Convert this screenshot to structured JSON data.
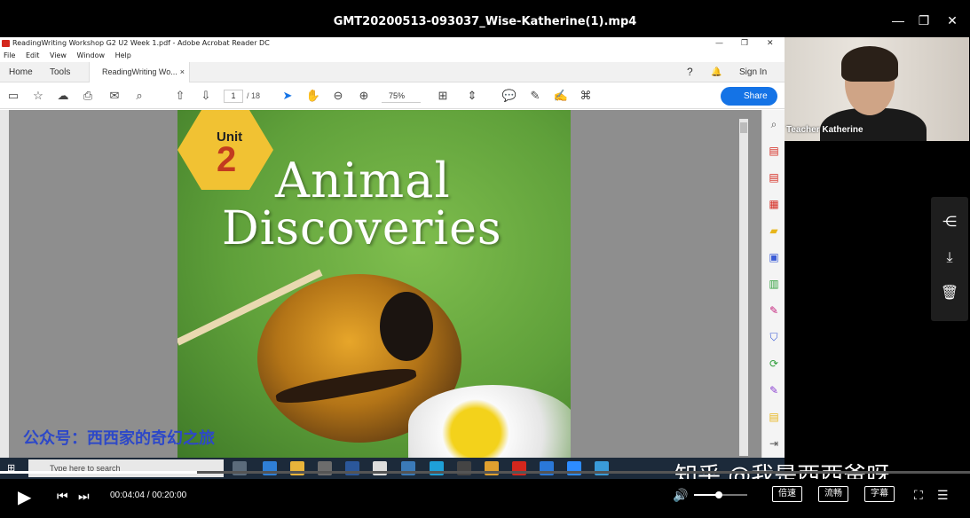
{
  "player": {
    "title": "GMT20200513-093037_Wise-Katherine(1).mp4",
    "time_current": "00:04:04",
    "time_total": "00:20:00",
    "time_display": "00:04:04 / 00:20:00",
    "progress_fraction": 0.203,
    "volume_fraction": 0.45,
    "speed_label": "倍速",
    "quality_label": "流畅",
    "subtitle_label": "字幕"
  },
  "acrobat": {
    "window_title": "ReadingWriting Workshop G2 U2 Week 1.pdf - Adobe Acrobat Reader DC",
    "menu": [
      "File",
      "Edit",
      "View",
      "Window",
      "Help"
    ],
    "tab_home": "Home",
    "tab_tools": "Tools",
    "tab_doc": "ReadingWriting Wo...",
    "tab_close": "×",
    "help_glyph": "?",
    "bell_glyph": "🔔",
    "sign_in": "Sign In",
    "page_current": "1",
    "page_total": "/ 18",
    "zoom": "75%",
    "share": "Share"
  },
  "cover": {
    "unit_label": "Unit",
    "unit_number": "2",
    "title_line1": "Animal",
    "title_line2": "Discoveries"
  },
  "watermark_left": "公众号：西西家的奇幻之旅",
  "watermark_right": "知乎 @我是西西爸呀",
  "taskbar": {
    "search_placeholder": "Type here to search"
  },
  "webcam": {
    "name": "Teacher Katherine"
  },
  "colors": {
    "share_button": "#1473e6",
    "watermark_blue": "#2d48c8",
    "pdf_red": "#d4271d"
  }
}
